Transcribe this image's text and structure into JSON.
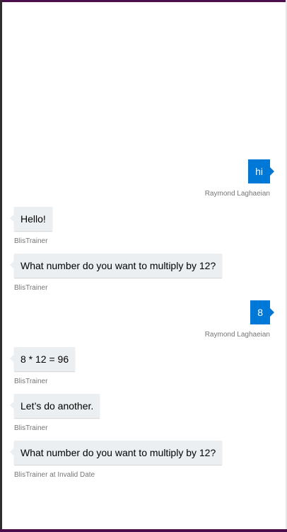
{
  "messages": [
    {
      "from": "user",
      "text": "hi",
      "meta": "Raymond Laghaeian"
    },
    {
      "from": "bot",
      "text": "Hello!",
      "meta": "BlisTrainer"
    },
    {
      "from": "bot",
      "text": "What number do you want to multiply by 12?",
      "meta": "BlisTrainer"
    },
    {
      "from": "user",
      "text": "8",
      "meta": "Raymond Laghaeian"
    },
    {
      "from": "bot",
      "text": "8 * 12 = 96",
      "meta": "BlisTrainer"
    },
    {
      "from": "bot",
      "text": "Let’s do another.",
      "meta": "BlisTrainer"
    },
    {
      "from": "bot",
      "text": "What number do you want to multiply by 12?",
      "meta": "BlisTrainer at Invalid Date"
    }
  ],
  "colors": {
    "frame": "#4b0f4e",
    "user_bubble": "#0078d7",
    "bot_bubble": "#eceff1",
    "meta_text": "#767676"
  }
}
